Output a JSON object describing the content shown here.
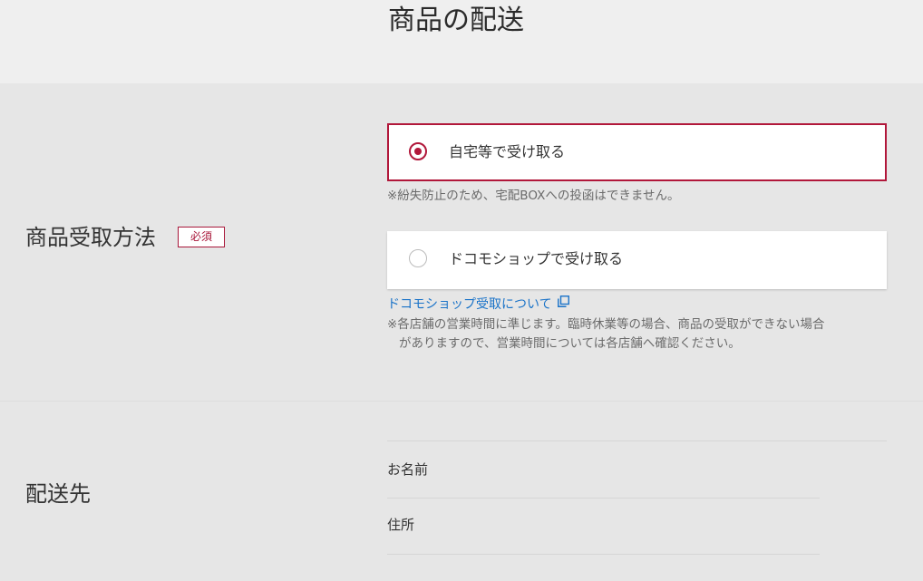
{
  "page": {
    "title": "商品の配送"
  },
  "receive_method": {
    "label": "商品受取方法",
    "required_badge": "必須",
    "options": [
      {
        "label": "自宅等で受け取る",
        "selected": true,
        "note": "※紛失防止のため、宅配BOXへの投函はできません。"
      },
      {
        "label": "ドコモショップで受け取る",
        "selected": false,
        "link_text": "ドコモショップ受取について",
        "link_icon": "external-window-icon",
        "note_line1": "※各店舗の営業時間に準じます。臨時休業等の場合、商品の受取ができない場合",
        "note_line2": "がありますので、営業時間については各店舗へ確認ください。"
      }
    ]
  },
  "delivery": {
    "label": "配送先",
    "fields": [
      {
        "label": "お名前"
      },
      {
        "label": "住所"
      }
    ]
  },
  "colors": {
    "accent": "#b1173a",
    "link": "#1a73c8",
    "background": "#e6e6e6",
    "header_background": "#efefef"
  }
}
